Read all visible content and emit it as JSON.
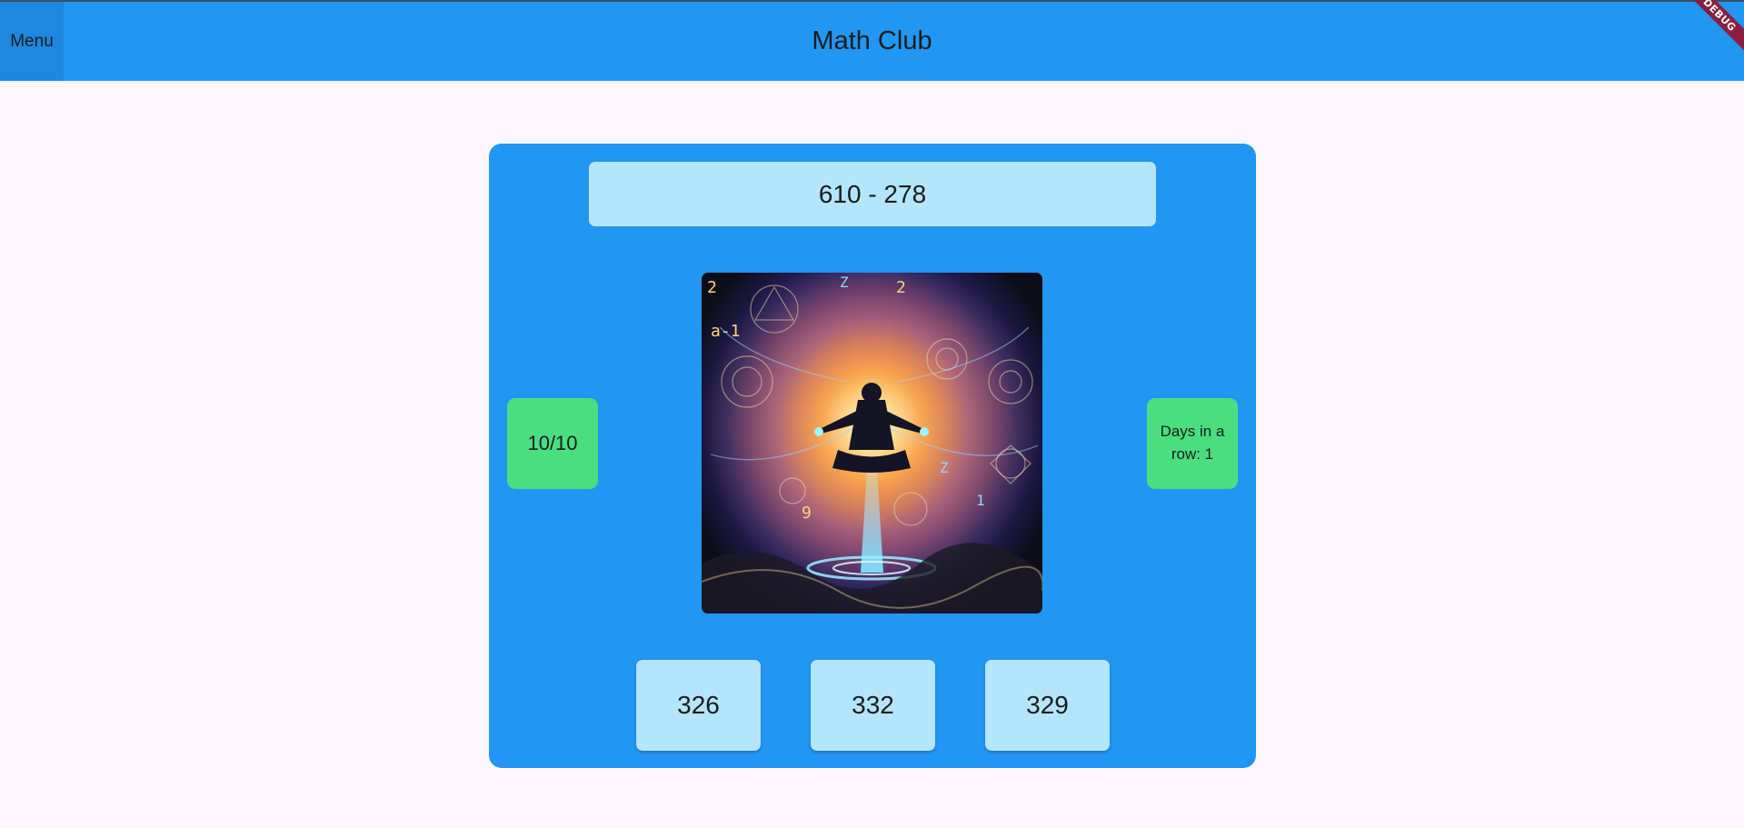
{
  "appbar": {
    "title": "Math Club",
    "menu_label": "Menu",
    "debug_label": "DEBUG"
  },
  "game": {
    "question": "610 - 278",
    "score": "10/10",
    "streak": "Days in a row: 1",
    "answers": [
      "326",
      "332",
      "329"
    ]
  },
  "colors": {
    "appbar": "#2196f3",
    "card": "#2196f3",
    "light_tile": "#b3e5fc",
    "green_tile": "#4ade80",
    "page_background": "#fef7ff"
  }
}
